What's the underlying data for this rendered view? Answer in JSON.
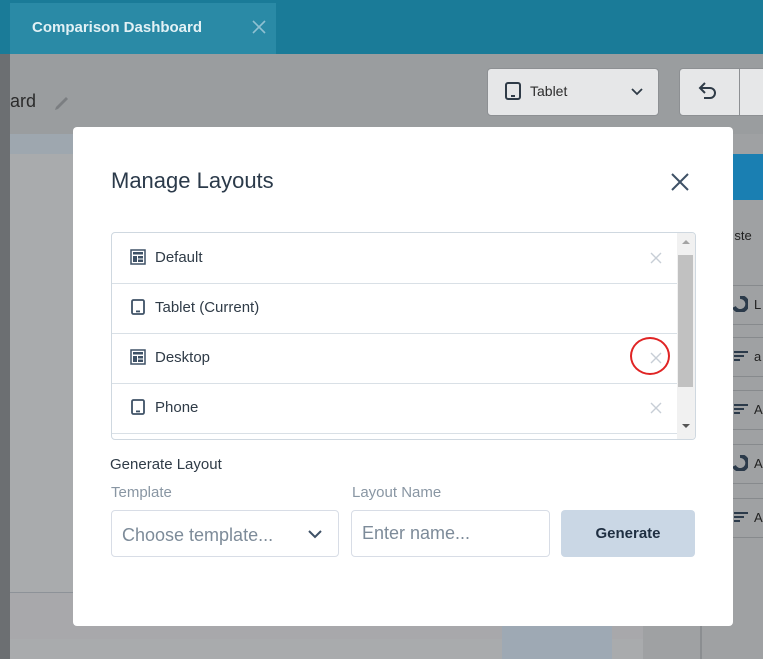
{
  "tab": {
    "title": "Comparison Dashboard"
  },
  "header": {
    "title_fragment": "ard"
  },
  "device_dropdown": {
    "selected": "Tablet"
  },
  "right_panel": {
    "partial_text": "ll ste",
    "items": [
      "L",
      "a",
      "A",
      "A",
      "A"
    ]
  },
  "modal": {
    "title": "Manage Layouts",
    "layouts": [
      {
        "label": "Default",
        "icon": "layout-icon",
        "removable": true
      },
      {
        "label": "Tablet (Current)",
        "icon": "tablet-icon",
        "removable": false
      },
      {
        "label": "Desktop",
        "icon": "layout-icon",
        "removable": true
      },
      {
        "label": "Phone",
        "icon": "tablet-icon",
        "removable": true
      }
    ],
    "generate": {
      "section_title": "Generate Layout",
      "template_label": "Template",
      "template_placeholder": "Choose template...",
      "name_label": "Layout Name",
      "name_placeholder": "Enter name...",
      "button_label": "Generate"
    }
  },
  "colors": {
    "tab_bar": "#1a7b98",
    "modal_title": "#2b3a4a",
    "generate_button": "#cad7e5",
    "highlight": "#e02424"
  }
}
